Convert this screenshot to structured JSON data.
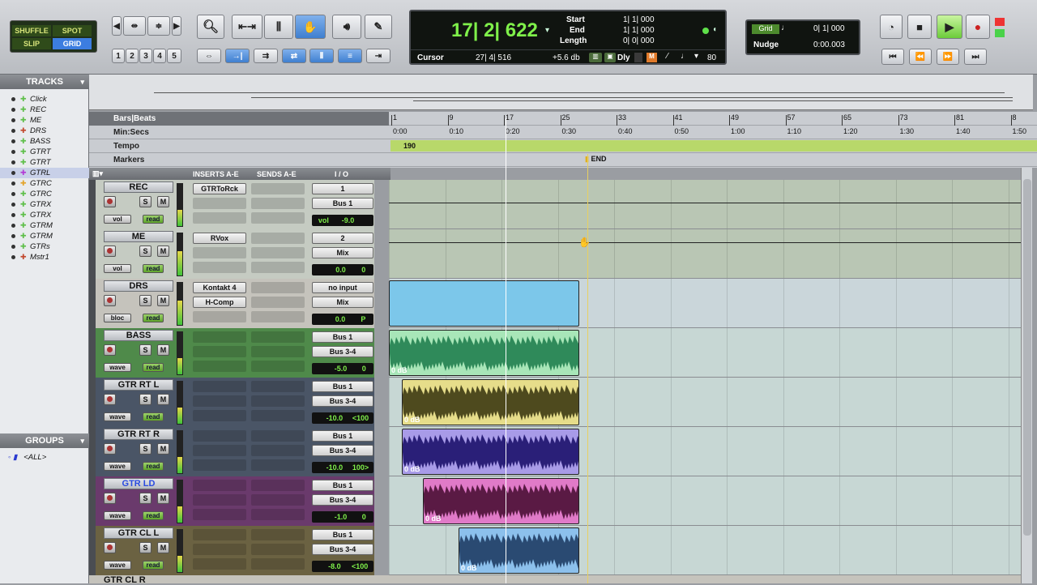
{
  "toolbar": {
    "modes": {
      "shuffle": "SHUFFLE",
      "spot": "SPOT",
      "slip": "SLIP",
      "grid": "GRID"
    },
    "zoom_presets": [
      "1",
      "2",
      "3",
      "4",
      "5"
    ],
    "counter": {
      "main": "17| 2| 622",
      "cursor_label": "Cursor",
      "cursor_value": "27| 4| 516",
      "db_value": "+5.6 db",
      "dly": "Dly",
      "tempo": "80"
    },
    "selection": {
      "start_label": "Start",
      "end_label": "End",
      "length_label": "Length",
      "start_value": "1| 1| 000",
      "end_value": "1| 1| 000",
      "length_value": "0| 0| 000"
    },
    "grid": {
      "grid_label": "Grid",
      "grid_value": "0| 1| 000",
      "nudge_label": "Nudge",
      "nudge_value": "0:00.003"
    }
  },
  "sidebar": {
    "tracks_title": "TRACKS",
    "groups_title": "GROUPS",
    "group_all": "<ALL>",
    "items": [
      {
        "name": "Click",
        "color": "#5fbf4a"
      },
      {
        "name": "REC",
        "color": "#5fbf4a"
      },
      {
        "name": "ME",
        "color": "#5fbf4a"
      },
      {
        "name": "DRS",
        "color": "#c2492e"
      },
      {
        "name": "BASS",
        "color": "#5fbf4a"
      },
      {
        "name": "GTRT",
        "color": "#5fbf4a"
      },
      {
        "name": "GTRT",
        "color": "#5fbf4a"
      },
      {
        "name": "GTRL",
        "color": "#b33bd6"
      },
      {
        "name": "GTRC",
        "color": "#e3a42b"
      },
      {
        "name": "GTRC",
        "color": "#5fbf4a"
      },
      {
        "name": "GTRX",
        "color": "#5fbf4a"
      },
      {
        "name": "GTRX",
        "color": "#5fbf4a"
      },
      {
        "name": "GTRM",
        "color": "#5fbf4a"
      },
      {
        "name": "GTRM",
        "color": "#5fbf4a"
      },
      {
        "name": "GTRs",
        "color": "#5fbf4a"
      },
      {
        "name": "Mstr1",
        "color": "#c2492e"
      }
    ]
  },
  "rulers": {
    "bars_label": "Bars|Beats",
    "minsecs_label": "Min:Secs",
    "tempo_label": "Tempo",
    "markers_label": "Markers",
    "bars": [
      "1",
      "9",
      "17",
      "25",
      "33",
      "41",
      "49",
      "57",
      "65",
      "73",
      "81",
      "8"
    ],
    "times": [
      "0:00",
      "0:10",
      "0:20",
      "0:30",
      "0:40",
      "0:50",
      "1:00",
      "1:10",
      "1:20",
      "1:30",
      "1:40",
      "1:50"
    ],
    "tempo_value": "190",
    "marker_end": "END"
  },
  "mix_header": {
    "inserts": "INSERTS A-E",
    "sends": "SENDS A-E",
    "io": "I / O"
  },
  "tracks": [
    {
      "name": "REC",
      "insert": "GTRToRck",
      "io1": "1",
      "io2": "Bus 1",
      "vol_label": "vol",
      "vol": "-9.0",
      "pan": "",
      "auto_a": "vol",
      "auto_b": "read",
      "bg": "#c5cbc2",
      "lane_bg": "#b9c6b4",
      "name_color": "#111"
    },
    {
      "name": "ME",
      "insert": "RVox",
      "io1": "2",
      "io2": "Mix",
      "vol_label": "",
      "vol": "0.0",
      "pan": "0",
      "auto_a": "vol",
      "auto_b": "read",
      "bg": "#c5cbc2",
      "lane_bg": "#b9c6b4",
      "name_color": "#111"
    },
    {
      "name": "DRS",
      "insert": "Kontakt 4",
      "insert2": "H-Comp",
      "io1": "no input",
      "io2": "Mix",
      "vol_label": "",
      "vol": "0.0",
      "pan": "P",
      "auto_a": "bloc",
      "auto_b": "read",
      "bg": "#c5c3bc",
      "lane_bg": "#cad6da",
      "name_color": "#111"
    },
    {
      "name": "BASS",
      "insert": "",
      "io1": "Bus 1",
      "io2": "Bus 3-4",
      "vol_label": "",
      "vol": "-5.0",
      "pan": "0",
      "auto_a": "wave",
      "auto_b": "read",
      "bg": "#4f8a4a",
      "lane_bg": "#c7d7d4",
      "name_color": "#111",
      "clip": "0 dB"
    },
    {
      "name": "GTR RT L",
      "insert": "",
      "io1": "Bus 1",
      "io2": "Bus 3-4",
      "vol_label": "",
      "vol": "-10.0",
      "pan": "<100",
      "auto_a": "wave",
      "auto_b": "read",
      "bg": "#4a5566",
      "lane_bg": "#c7d7d4",
      "name_color": "#111",
      "clip": "0 dB"
    },
    {
      "name": "GTR RT R",
      "insert": "",
      "io1": "Bus 1",
      "io2": "Bus 3-4",
      "vol_label": "",
      "vol": "-10.0",
      "pan": "100>",
      "auto_a": "wave",
      "auto_b": "read",
      "bg": "#4a5566",
      "lane_bg": "#c7d7d4",
      "name_color": "#111",
      "clip": "0 dB"
    },
    {
      "name": "GTR LD",
      "insert": "",
      "io1": "Bus 1",
      "io2": "Bus 3-4",
      "vol_label": "",
      "vol": "-1.0",
      "pan": "0",
      "auto_a": "wave",
      "auto_b": "read",
      "bg": "#6a3a6c",
      "lane_bg": "#c7d7d4",
      "name_color": "#2a4be0",
      "clip": "0 dB"
    },
    {
      "name": "GTR CL L",
      "insert": "",
      "io1": "Bus 1",
      "io2": "Bus 3-4",
      "vol_label": "",
      "vol": "-8.0",
      "pan": "<100",
      "auto_a": "wave",
      "auto_b": "read",
      "bg": "#6b6242",
      "lane_bg": "#c7d7d4",
      "name_color": "#111",
      "clip": "0 dB"
    }
  ],
  "partial_track": "GTR CL R"
}
